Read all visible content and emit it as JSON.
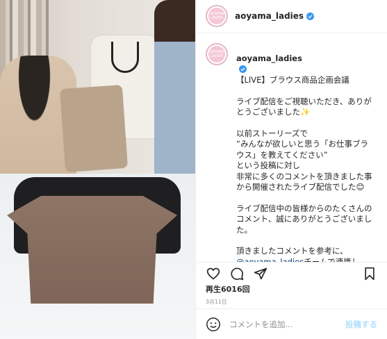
{
  "account": {
    "username": "aoyama_ladies",
    "avatar_text": "AOYAMA LADIES",
    "verified_icon": "verified-badge-icon"
  },
  "caption": {
    "username": "aoyama_ladies",
    "title": "【LIVE】ブラウス商品企画会議",
    "para1": "ライブ配信をご視聴いただき、ありがとうございました",
    "para1_emoji": "✨",
    "para2": "以前ストーリーズで\n“みんなが欲しいと思う「お仕事ブラウス」を教えてください”\nという投稿に対し\n非常に多くのコメントを頂きました事から開催されたライブ配信でした",
    "para2_emoji": "😊",
    "para3": "ライブ配信中の皆様からのたくさんのコメント、誠にありがとうございました。",
    "para4_prefix": "頂きましたコメントを参考に、",
    "para4_mention": "@aoyama_ladies",
    "para4_suffix": "チームで連携し、商"
  },
  "actions": {
    "like_icon": "heart-icon",
    "comment_icon": "comment-icon",
    "share_icon": "paper-plane-icon",
    "save_icon": "bookmark-icon"
  },
  "stats": {
    "views": "再生6016回",
    "date": "3月11日"
  },
  "comment": {
    "placeholder": "コメントを追加...",
    "post_label": "投稿する",
    "emoji_icon": "smiley-icon"
  },
  "colors": {
    "verified_blue": "#3897f0",
    "mention_blue": "#00376b",
    "post_disabled": "#b2dffc"
  }
}
